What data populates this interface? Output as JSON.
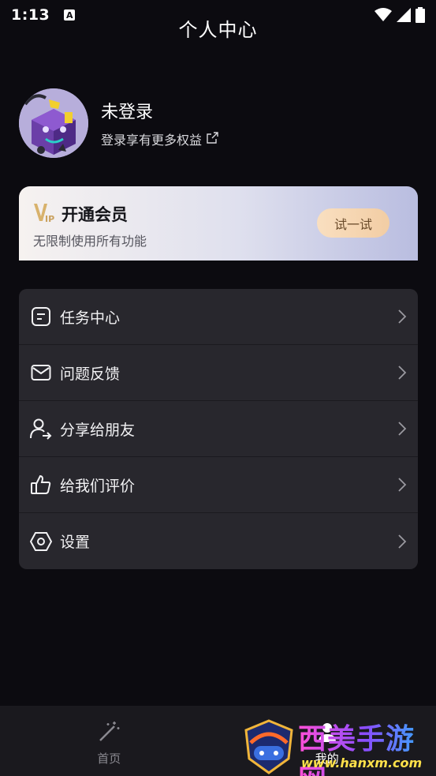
{
  "status_bar": {
    "time": "1:13",
    "badge": "A"
  },
  "header": {
    "title": "个人中心"
  },
  "profile": {
    "name": "未登录",
    "subtitle": "登录享有更多权益"
  },
  "vip": {
    "logo": "VIP",
    "title": "开通会员",
    "subtitle": "无限制使用所有功能",
    "button_label": "试一试"
  },
  "menu": {
    "items": [
      {
        "label": "任务中心",
        "icon": "task-icon"
      },
      {
        "label": "问题反馈",
        "icon": "mail-icon"
      },
      {
        "label": "分享给朋友",
        "icon": "share-user-icon"
      },
      {
        "label": "给我们评价",
        "icon": "thumbs-up-icon"
      },
      {
        "label": "设置",
        "icon": "settings-hex-icon"
      }
    ]
  },
  "tabbar": {
    "tabs": [
      {
        "label": "首页",
        "icon": "magic-wand-icon"
      },
      {
        "label": "我的",
        "icon": "user-icon"
      }
    ]
  },
  "watermark": {
    "title": "西美手游网",
    "url": "www.hanxm.com"
  }
}
